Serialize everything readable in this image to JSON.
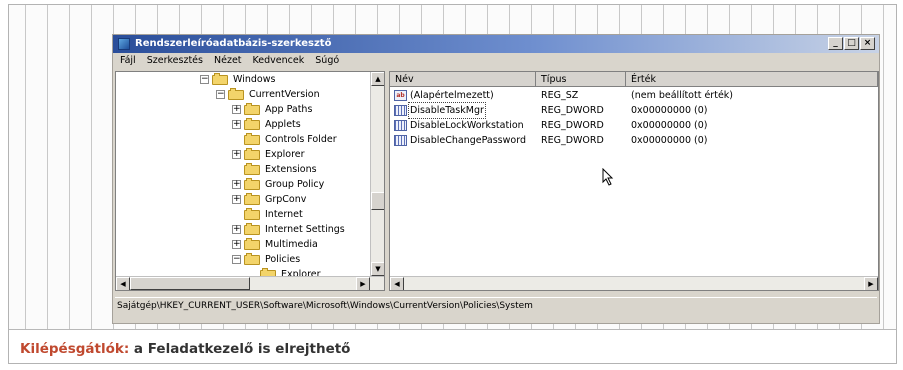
{
  "window": {
    "title": "Rendszerleíróadatbázis-szerkesztő",
    "buttons": [
      "_",
      "□",
      "×"
    ]
  },
  "menu": [
    "Fájl",
    "Szerkesztés",
    "Nézet",
    "Kedvencek",
    "Súgó"
  ],
  "tree": [
    {
      "label": "Windows",
      "expander": "−",
      "level": 0
    },
    {
      "label": "CurrentVersion",
      "expander": "−",
      "level": 1
    },
    {
      "label": "App Paths",
      "expander": "+",
      "level": 2
    },
    {
      "label": "Applets",
      "expander": "+",
      "level": 2
    },
    {
      "label": "Controls Folder",
      "expander": "",
      "level": 2
    },
    {
      "label": "Explorer",
      "expander": "+",
      "level": 2
    },
    {
      "label": "Extensions",
      "expander": "",
      "level": 2
    },
    {
      "label": "Group Policy",
      "expander": "+",
      "level": 2
    },
    {
      "label": "GrpConv",
      "expander": "+",
      "level": 2
    },
    {
      "label": "Internet",
      "expander": "",
      "level": 2
    },
    {
      "label": "Internet Settings",
      "expander": "+",
      "level": 2
    },
    {
      "label": "Multimedia",
      "expander": "+",
      "level": 2
    },
    {
      "label": "Policies",
      "expander": "−",
      "level": 2
    },
    {
      "label": "Explorer",
      "expander": "",
      "level": 3
    }
  ],
  "list": {
    "columns": [
      "Név",
      "Típus",
      "Érték"
    ],
    "rows": [
      {
        "name": "(Alapértelmezett)",
        "type": "REG_SZ",
        "value": "(nem beállított érték)",
        "icon": "ab"
      },
      {
        "name": "DisableTaskMgr",
        "type": "REG_DWORD",
        "value": "0x00000000 (0)",
        "icon": "dword",
        "selected": true
      },
      {
        "name": "DisableLockWorkstation",
        "type": "REG_DWORD",
        "value": "0x00000000 (0)",
        "icon": "dword"
      },
      {
        "name": "DisableChangePassword",
        "type": "REG_DWORD",
        "value": "0x00000000 (0)",
        "icon": "dword"
      }
    ]
  },
  "status": "Sajátgép\\HKEY_CURRENT_USER\\Software\\Microsoft\\Windows\\CurrentVersion\\Policies\\System",
  "caption": {
    "label": "Kilépésgátlók:",
    "text": " a Feladatkezelő is elrejthető"
  },
  "colors": {
    "caption_label": "#c0492f",
    "titlebar_start": "#2a4e9a",
    "folder": "#f3d46a"
  }
}
